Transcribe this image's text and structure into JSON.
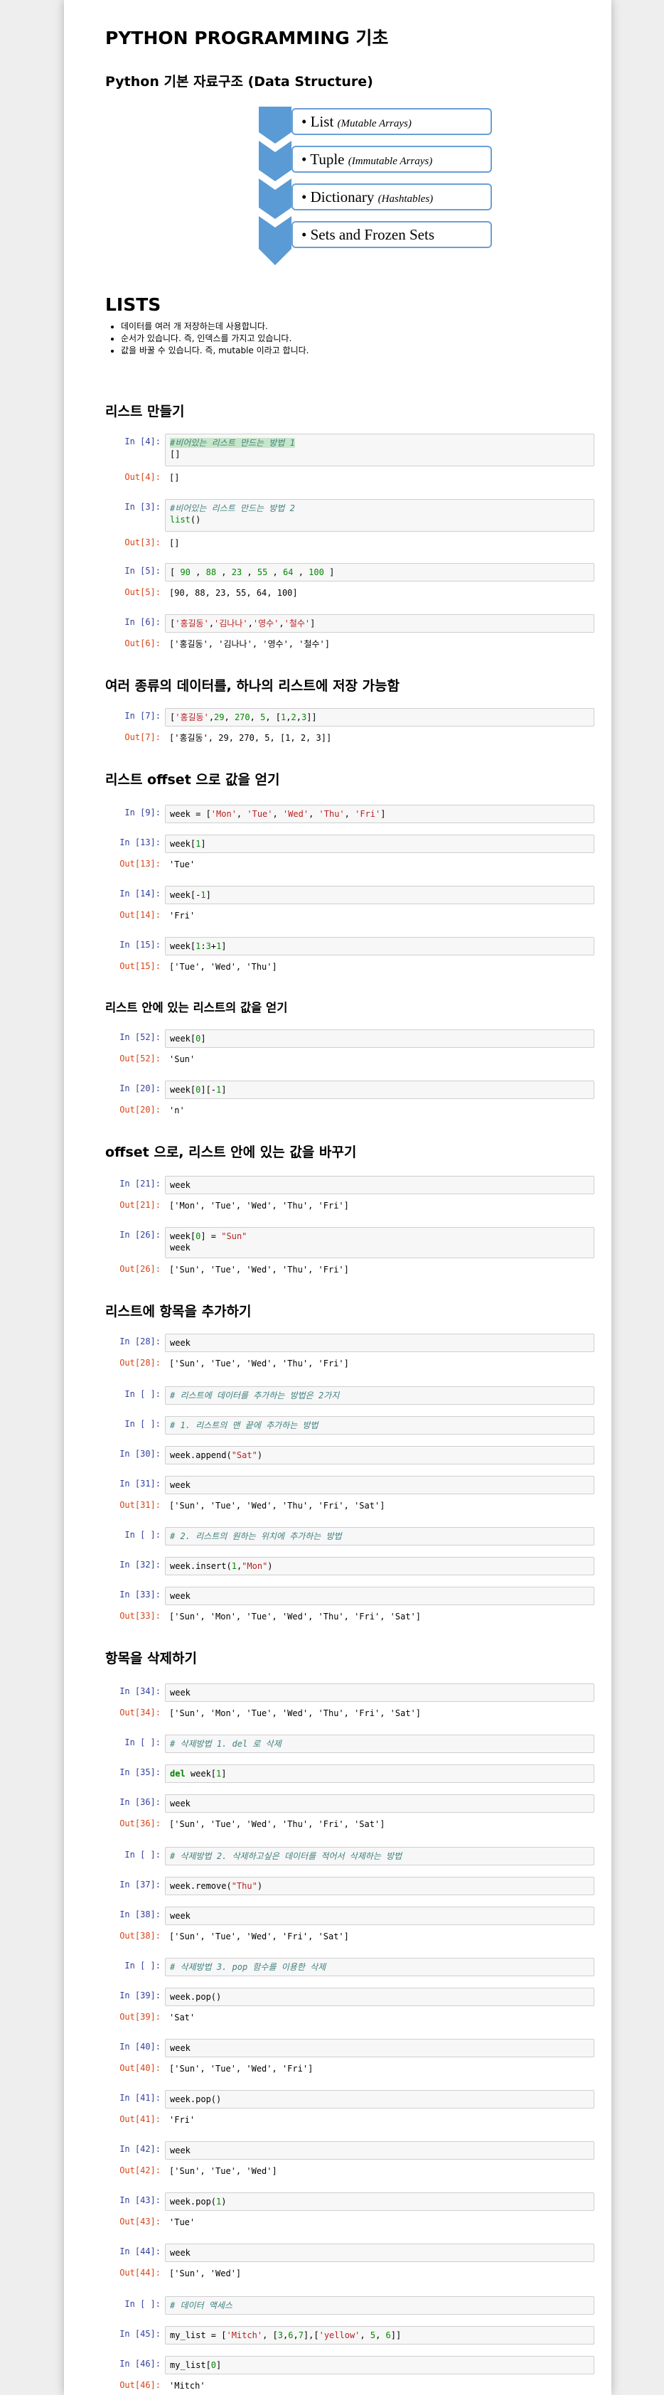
{
  "title": "PYTHON PROGRAMMING 기초",
  "subtitle": "Python 기본 자료구조 (Data Structure)",
  "diagram": [
    {
      "name": "List",
      "note": "(Mutable Arrays)"
    },
    {
      "name": "Tuple",
      "note": "(Immutable Arrays)"
    },
    {
      "name": "Dictionary",
      "note": "(Hashtables)"
    },
    {
      "name": "Sets and Frozen Sets",
      "note": ""
    }
  ],
  "lists_heading": "LISTS",
  "lists_bullets": [
    "데이터를 여러 개 저장하는데 사용합니다.",
    "순서가 있습니다. 즉, 인덱스를 가지고 있습니다.",
    "값을 바꿀 수 있습니다. 즉, mutable 이라고 합니다."
  ],
  "headings": {
    "make": "리스트 만들기",
    "various": "여러 종류의 데이터를, 하나의 리스트에 저장 가능함",
    "offset": "리스트 offset 으로 값을 얻기",
    "nested": "리스트 안에 있는 리스트의 값을 얻기",
    "change": "offset 으로, 리스트 안에 있는 값을 바꾸기",
    "add": "리스트에 항목을 추가하기",
    "delete": "항목을 삭제하기"
  },
  "cells": [
    {
      "in": "In [4]:",
      "code": "#비어있는 리스트 만드는 방법 1\n[]",
      "out": "Out[4]:",
      "result": "[]"
    },
    {
      "in": "In [3]:",
      "code": "#비어있는 리스트 만드는 방법 2\nlist()",
      "out": "Out[3]:",
      "result": "[]"
    },
    {
      "in": "In [5]:",
      "code": "[ 90 , 88 , 23 , 55 , 64 , 100 ]",
      "out": "Out[5]:",
      "result": "[90, 88, 23, 55, 64, 100]"
    },
    {
      "in": "In [6]:",
      "code": "['홍길동','김나나','영수','철수']",
      "out": "Out[6]:",
      "result": "['홍길동', '김나나', '영수', '철수']"
    },
    {
      "in": "In [7]:",
      "code": "['홍길동',29, 270, 5, [1,2,3]]",
      "out": "Out[7]:",
      "result": "['홍길동', 29, 270, 5, [1, 2, 3]]"
    },
    {
      "in": "In [9]:",
      "code": "week = ['Mon', 'Tue', 'Wed', 'Thu', 'Fri']",
      "out": "",
      "result": ""
    },
    {
      "in": "In [13]:",
      "code": "week[1]",
      "out": "Out[13]:",
      "result": "'Tue'"
    },
    {
      "in": "In [14]:",
      "code": "week[-1]",
      "out": "Out[14]:",
      "result": "'Fri'"
    },
    {
      "in": "In [15]:",
      "code": "week[1:3+1]",
      "out": "Out[15]:",
      "result": "['Tue', 'Wed', 'Thu']"
    },
    {
      "in": "In [52]:",
      "code": "week[0]",
      "out": "Out[52]:",
      "result": "'Sun'"
    },
    {
      "in": "In [20]:",
      "code": "week[0][-1]",
      "out": "Out[20]:",
      "result": "'n'"
    },
    {
      "in": "In [21]:",
      "code": "week",
      "out": "Out[21]:",
      "result": "['Mon', 'Tue', 'Wed', 'Thu', 'Fri']"
    },
    {
      "in": "In [26]:",
      "code": "week[0] = \"Sun\"\nweek",
      "out": "Out[26]:",
      "result": "['Sun', 'Tue', 'Wed', 'Thu', 'Fri']"
    },
    {
      "in": "In [28]:",
      "code": "week",
      "out": "Out[28]:",
      "result": "['Sun', 'Tue', 'Wed', 'Thu', 'Fri']"
    },
    {
      "in": "In [ ]:",
      "code": "# 리스트에 데이터를 추가하는 방법은 2가지",
      "out": "",
      "result": ""
    },
    {
      "in": "In [ ]:",
      "code": "# 1. 리스트의 맨 끝에 추가하는 방법",
      "out": "",
      "result": ""
    },
    {
      "in": "In [30]:",
      "code": "week.append(\"Sat\")",
      "out": "",
      "result": ""
    },
    {
      "in": "In [31]:",
      "code": "week",
      "out": "Out[31]:",
      "result": "['Sun', 'Tue', 'Wed', 'Thu', 'Fri', 'Sat']"
    },
    {
      "in": "In [ ]:",
      "code": "# 2. 리스트의 원하는 위치에 추가하는 방법",
      "out": "",
      "result": ""
    },
    {
      "in": "In [32]:",
      "code": "week.insert(1,\"Mon\")",
      "out": "",
      "result": ""
    },
    {
      "in": "In [33]:",
      "code": "week",
      "out": "Out[33]:",
      "result": "['Sun', 'Mon', 'Tue', 'Wed', 'Thu', 'Fri', 'Sat']"
    },
    {
      "in": "In [34]:",
      "code": "week",
      "out": "Out[34]:",
      "result": "['Sun', 'Mon', 'Tue', 'Wed', 'Thu', 'Fri', 'Sat']"
    },
    {
      "in": "In [ ]:",
      "code": "# 삭제방법 1. del 로 삭제",
      "out": "",
      "result": ""
    },
    {
      "in": "In [35]:",
      "code": "del week[1]",
      "out": "",
      "result": ""
    },
    {
      "in": "In [36]:",
      "code": "week",
      "out": "Out[36]:",
      "result": "['Sun', 'Tue', 'Wed', 'Thu', 'Fri', 'Sat']"
    },
    {
      "in": "In [ ]:",
      "code": "# 삭제방법 2. 삭제하고싶은 데이터를 적어서 삭제하는 방법",
      "out": "",
      "result": ""
    },
    {
      "in": "In [37]:",
      "code": "week.remove(\"Thu\")",
      "out": "",
      "result": ""
    },
    {
      "in": "In [38]:",
      "code": "week",
      "out": "Out[38]:",
      "result": "['Sun', 'Tue', 'Wed', 'Fri', 'Sat']"
    },
    {
      "in": "In [ ]:",
      "code": "# 삭제방법 3. pop 함수를 이용한 삭제",
      "out": "",
      "result": ""
    },
    {
      "in": "In [39]:",
      "code": "week.pop()",
      "out": "Out[39]:",
      "result": "'Sat'"
    },
    {
      "in": "In [40]:",
      "code": "week",
      "out": "Out[40]:",
      "result": "['Sun', 'Tue', 'Wed', 'Fri']"
    },
    {
      "in": "In [41]:",
      "code": "week.pop()",
      "out": "Out[41]:",
      "result": "'Fri'"
    },
    {
      "in": "In [42]:",
      "code": "week",
      "out": "Out[42]:",
      "result": "['Sun', 'Tue', 'Wed']"
    },
    {
      "in": "In [43]:",
      "code": "week.pop(1)",
      "out": "Out[43]:",
      "result": "'Tue'"
    },
    {
      "in": "In [44]:",
      "code": "week",
      "out": "Out[44]:",
      "result": "['Sun', 'Wed']"
    },
    {
      "in": "In [ ]:",
      "code": "# 데이터 액세스",
      "out": "",
      "result": ""
    },
    {
      "in": "In [45]:",
      "code": "my_list = ['Mitch', [3,6,7],['yellow', 5, 6]]",
      "out": "",
      "result": ""
    },
    {
      "in": "In [46]:",
      "code": "my_list[0]",
      "out": "Out[46]:",
      "result": "'Mitch'"
    }
  ],
  "colors": {
    "in_prompt": "#303f9f",
    "out_prompt": "#d84315",
    "diagram_blue": "#5b9bd5"
  }
}
